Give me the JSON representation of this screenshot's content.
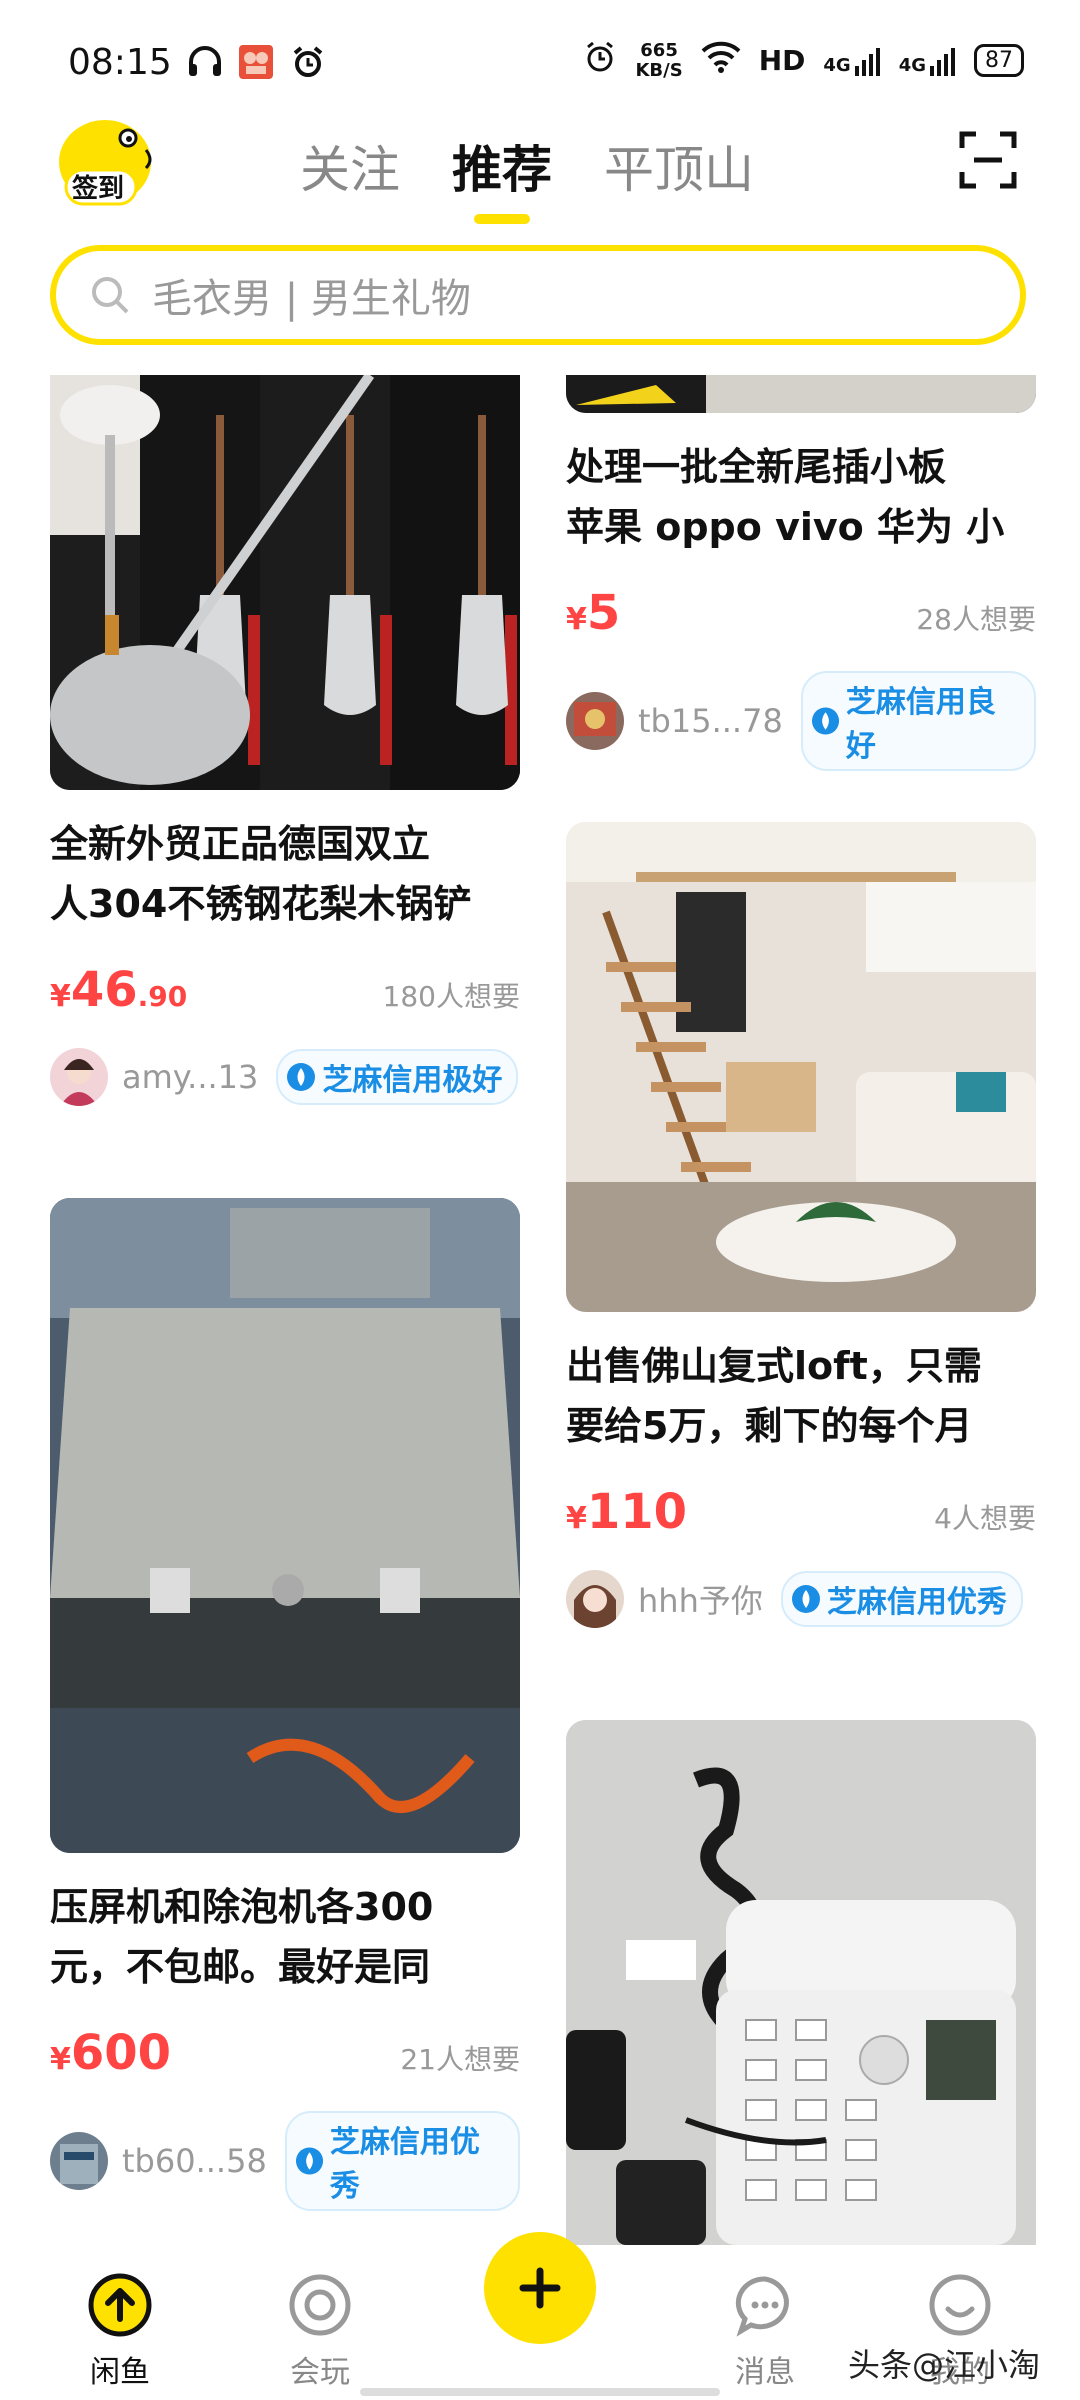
{
  "status_bar": {
    "time": "08:15",
    "net_speed_value": "665",
    "net_speed_unit": "KB/S",
    "network_label": "HD",
    "signal1_label": "4G",
    "signal2_label": "4G",
    "battery": "87"
  },
  "header": {
    "checkin_label": "签到",
    "tabs": [
      {
        "label": "关注",
        "active": false
      },
      {
        "label": "推荐",
        "active": true
      },
      {
        "label": "平顶山",
        "active": false
      }
    ]
  },
  "search": {
    "placeholder": "毛衣男 | 男生礼物"
  },
  "feed": {
    "left": [
      {
        "title_line1": "全新外贸正品德国双立",
        "title_line2": "人304不锈钢花梨木锅铲",
        "price_currency": "¥",
        "price_int": "46",
        "price_dec": ".90",
        "wants": "180人想要",
        "user": "amy...13",
        "credit": "芝麻信用极好"
      },
      {
        "title_line1": "压屏机和除泡机各300",
        "title_line2": "元，不包邮。最好是同",
        "price_currency": "¥",
        "price_int": "600",
        "wants": "21人想要",
        "user": "tb60...58",
        "credit": "芝麻信用优秀"
      }
    ],
    "right": [
      {
        "title_line1": "处理一批全新尾插小板",
        "title_line2": "苹果 oppo vivo 华为 小",
        "price_currency": "¥",
        "price_int": "5",
        "wants": "28人想要",
        "user": "tb15...78",
        "credit": "芝麻信用良好"
      },
      {
        "title_line1": "出售佛山复式loft，只需",
        "title_line2": "要给5万，剩下的每个月",
        "price_currency": "¥",
        "price_int": "110",
        "wants": "4人想要",
        "user": "hhh予你",
        "credit": "芝麻信用优秀"
      }
    ]
  },
  "bottom_nav": {
    "items": [
      {
        "label": "闲鱼",
        "active": true
      },
      {
        "label": "会玩",
        "active": false
      },
      {
        "label": "消息",
        "active": false
      },
      {
        "label": "我的",
        "active": false
      }
    ]
  },
  "watermark": "头条@江小淘",
  "colors": {
    "brand_yellow": "#ffe100",
    "price_red": "#ff4444",
    "credit_blue": "#1a8de4"
  }
}
